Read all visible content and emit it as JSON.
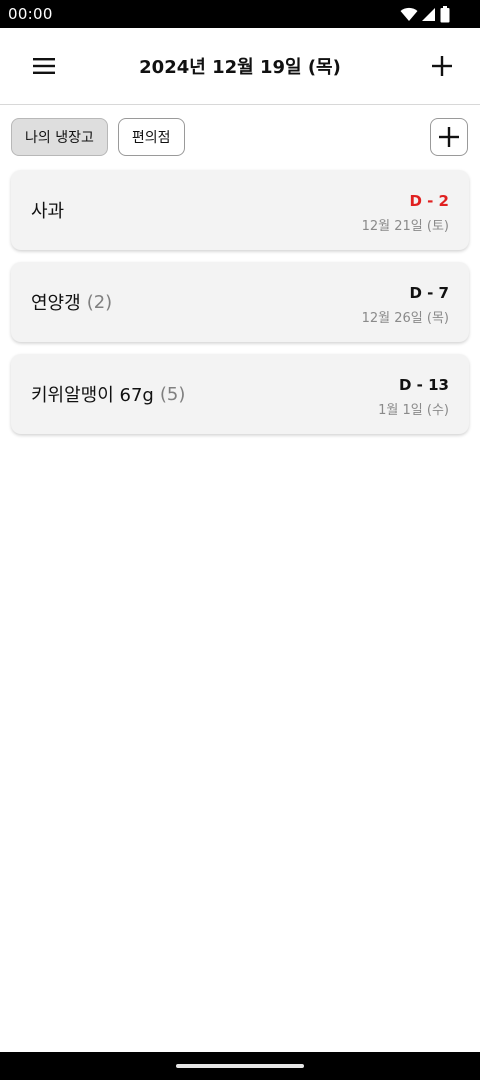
{
  "status_bar": {
    "time": "00:00",
    "icons": [
      "wifi-icon",
      "signal-icon",
      "battery-icon"
    ]
  },
  "app_bar": {
    "title": "2024년 12월 19일 (목)",
    "menu_icon": "hamburger-menu-icon",
    "add_icon": "plus-icon"
  },
  "tabs": {
    "items": [
      {
        "label": "나의 냉장고",
        "selected": true
      },
      {
        "label": "편의점",
        "selected": false
      }
    ],
    "add_icon": "plus-icon"
  },
  "items": [
    {
      "name": "사과",
      "count": "",
      "dday": "D - 2",
      "date": "12월 21일 (토)",
      "urgent": true
    },
    {
      "name": "연양갱",
      "count": "(2)",
      "dday": "D - 7",
      "date": "12월 26일 (목)",
      "urgent": false
    },
    {
      "name": "키위알맹이 67g",
      "count": "(5)",
      "dday": "D - 13",
      "date": "1월 1일 (수)",
      "urgent": false
    }
  ],
  "colors": {
    "urgent": "#e02020",
    "card_background": "#f3f3f3",
    "selected_tab": "#dedede"
  }
}
